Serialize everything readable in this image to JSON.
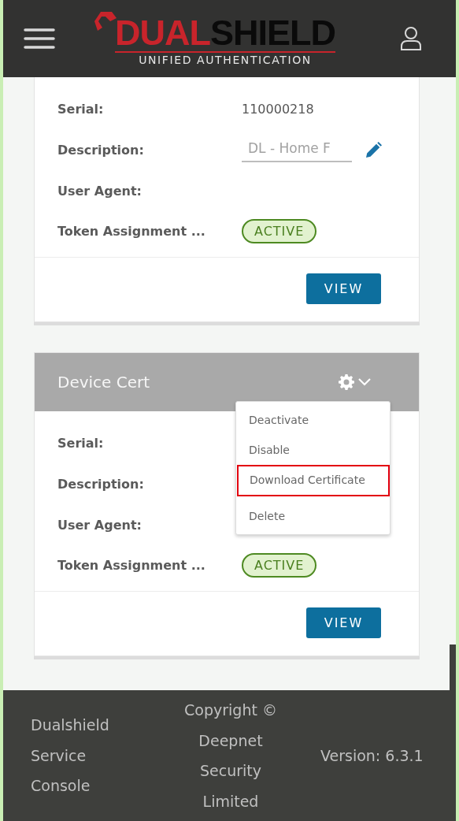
{
  "header": {
    "logo": {
      "primary": "DUAL",
      "secondary": "SHIELD",
      "tagline": "UNIFIED AUTHENTICATION"
    }
  },
  "cards": [
    {
      "fields": [
        {
          "kind": "text",
          "label": "Serial:",
          "value": "110000218"
        },
        {
          "kind": "input",
          "label": "Description:",
          "value": "DL - Home F"
        },
        {
          "kind": "text",
          "label": "User Agent:"
        },
        {
          "kind": "status",
          "label": "Token Assignment ...",
          "value": "ACTIVE"
        }
      ],
      "button": "VIEW"
    },
    {
      "title": "Device Cert",
      "menu_open": true,
      "menu": [
        {
          "label": "Deactivate",
          "highlighted": false
        },
        {
          "label": "Disable",
          "highlighted": false
        },
        {
          "label": "Download Certificate",
          "highlighted": true
        },
        {
          "label": "Delete",
          "highlighted": false
        }
      ],
      "fields": [
        {
          "kind": "text",
          "label": "Serial:"
        },
        {
          "kind": "text",
          "label": "Description:"
        },
        {
          "kind": "text",
          "label": "User Agent:"
        },
        {
          "kind": "status",
          "label": "Token Assignment ...",
          "value": "ACTIVE"
        }
      ],
      "button": "VIEW"
    }
  ],
  "footer": {
    "product": "Dualshield Service Console",
    "copyright": "Copyright © Deepnet Security Limited",
    "version": "Version: 6.3.1"
  }
}
